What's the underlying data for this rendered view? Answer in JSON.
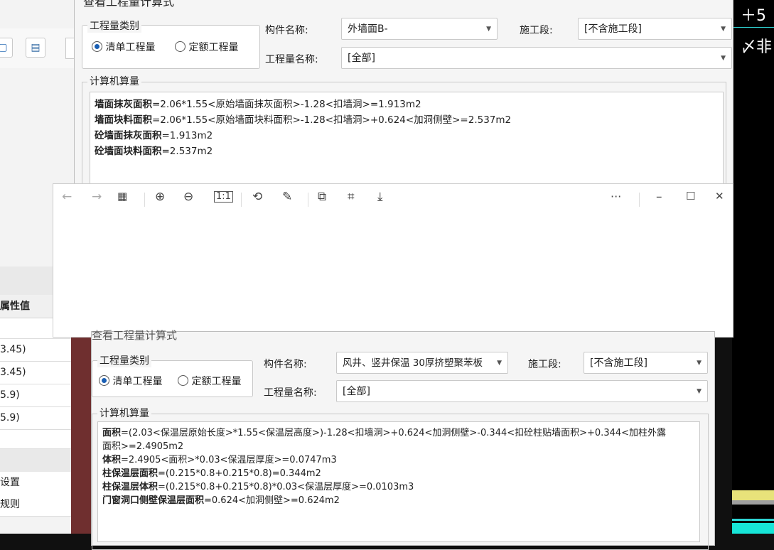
{
  "left_panel": {
    "toolbar_icons": [
      "blue-square-icon",
      "save-icon"
    ],
    "prop_header": "属性值",
    "rows": [
      "3.45)",
      "3.45)",
      "5.9)",
      "5.9)"
    ],
    "bottom_items": [
      "设置",
      "规则"
    ]
  },
  "cad": {
    "text_top": "＋5",
    "text_mid": "〆非"
  },
  "dialog_top": {
    "title": "查看工程量计算式",
    "group_title": "工程量类别",
    "radio1": "清单工程量",
    "radio2": "定额工程量",
    "component_label": "构件名称:",
    "component_value": "外墙面B-",
    "stage_label": "施工段:",
    "stage_value": "[不含施工段]",
    "qty_label": "工程量名称:",
    "qty_value": "[全部]",
    "calc_title": "计算机算量",
    "lines": [
      {
        "b": "墙面抹灰面积",
        "t": "=2.06*1.55<原始墙面抹灰面积>-1.28<扣墙洞>=1.913m2"
      },
      {
        "b": "墙面块料面积",
        "t": "=2.06*1.55<原始墙面块料面积>-1.28<扣墙洞>+0.624<加洞侧壁>=2.537m2"
      },
      {
        "b": "砼墙面抹灰面积",
        "t": "=1.913m2"
      },
      {
        "b": "砼墙面块料面积",
        "t": "=2.537m2"
      }
    ]
  },
  "dialog_bottom": {
    "title": "查看工程量计算式",
    "group_title": "工程量类别",
    "radio1": "清单工程量",
    "radio2": "定额工程量",
    "component_label": "构件名称:",
    "component_value": "风井、竖井保温  30厚挤塑聚苯板",
    "stage_label": "施工段:",
    "stage_value": "[不含施工段]",
    "qty_label": "工程量名称:",
    "qty_value": "[全部]",
    "calc_title": "计算机算量",
    "lines": [
      {
        "b": "面积",
        "t": "=(2.03<保温层原始长度>*1.55<保温层高度>)-1.28<扣墙洞>+0.624<加洞侧壁>-0.344<扣砼柱贴墙面积>+0.344<加柱外露"
      },
      {
        "b": "",
        "t": "面积>=2.4905m2"
      },
      {
        "b": "体积",
        "t": "=2.4905<面积>*0.03<保温层厚度>=0.0747m3"
      },
      {
        "b": "柱保温层面积",
        "t": "=(0.215*0.8+0.215*0.8)=0.344m2"
      },
      {
        "b": "柱保温层体积",
        "t": "=(0.215*0.8+0.215*0.8)*0.03<保温层厚度>=0.0103m3"
      },
      {
        "b": "门窗洞口侧壁保温层面积",
        "t": "=0.624<加洞侧壁>=0.624m2"
      }
    ]
  },
  "viewer": {
    "back": "←",
    "forward": "→",
    "more": "···",
    "minimize": "–",
    "maximize": "☐",
    "close": "✕"
  }
}
